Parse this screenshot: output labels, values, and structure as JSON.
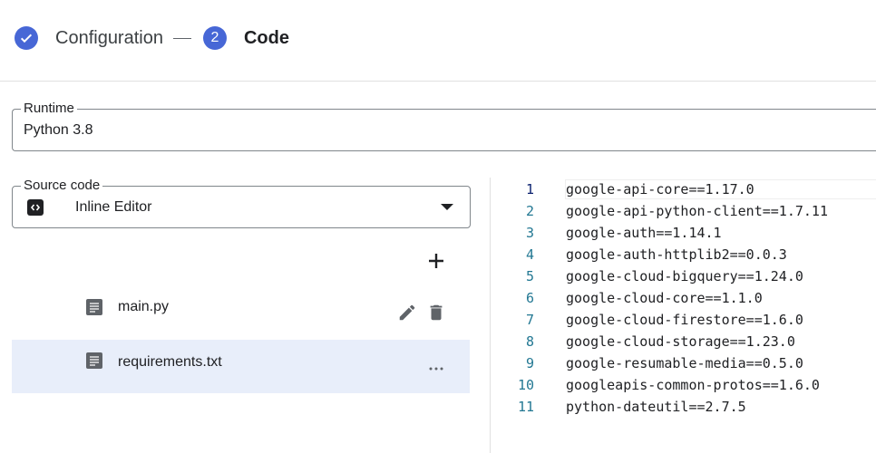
{
  "stepper": {
    "step1_label": "Configuration",
    "step2_number": "2",
    "step2_label": "Code"
  },
  "runtime": {
    "label": "Runtime",
    "value": "Python 3.8"
  },
  "source_code": {
    "label": "Source code",
    "value": "Inline Editor",
    "icon": "code-brackets-icon"
  },
  "files": [
    {
      "name": "main.py"
    },
    {
      "name": "requirements.txt"
    }
  ],
  "icons": {
    "add": "plus-icon",
    "file": "document-icon",
    "edit": "pencil-icon",
    "delete": "trash-icon",
    "more": "more-horizontal-icon"
  },
  "editor": {
    "lines": [
      {
        "num": "1",
        "text": "google-api-core==1.17.0"
      },
      {
        "num": "2",
        "text": "google-api-python-client==1.7.11"
      },
      {
        "num": "3",
        "text": "google-auth==1.14.1"
      },
      {
        "num": "4",
        "text": "google-auth-httplib2==0.0.3"
      },
      {
        "num": "5",
        "text": "google-cloud-bigquery==1.24.0"
      },
      {
        "num": "6",
        "text": "google-cloud-core==1.1.0"
      },
      {
        "num": "7",
        "text": "google-cloud-firestore==1.6.0"
      },
      {
        "num": "8",
        "text": "google-cloud-storage==1.23.0"
      },
      {
        "num": "9",
        "text": "google-resumable-media==0.5.0"
      },
      {
        "num": "10",
        "text": "googleapis-common-protos==1.6.0"
      },
      {
        "num": "11",
        "text": "python-dateutil==2.7.5"
      }
    ]
  },
  "colors": {
    "accent": "#4767d6",
    "selected_row": "#e8eefa",
    "line_number": "#237893"
  }
}
